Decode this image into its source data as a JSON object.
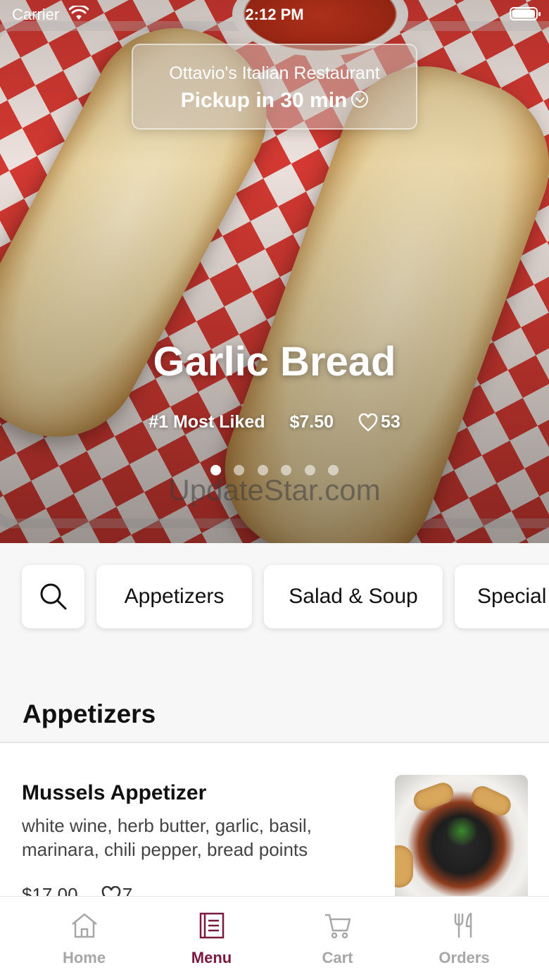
{
  "status_bar": {
    "carrier": "Carrier",
    "time": "2:12 PM"
  },
  "header": {
    "restaurant_name": "Ottavio's Italian Restaurant",
    "pickup_label": "Pickup in 30 min"
  },
  "featured": {
    "title": "Garlic Bread",
    "rank": "#1 Most Liked",
    "price": "$7.50",
    "likes": "53",
    "carousel_pages": 6,
    "carousel_active": 1,
    "watermark": "UpdateStar.com"
  },
  "categories": [
    "Appetizers",
    "Salad & Soup",
    "Special"
  ],
  "section": {
    "title": "Appetizers"
  },
  "items": [
    {
      "name": "Mussels Appetizer",
      "description": "white wine, herb butter, garlic, basil, marinara, chili pepper, bread points",
      "price": "$17.00",
      "likes": "7"
    }
  ],
  "tabs": [
    {
      "label": "Home",
      "icon": "home-icon",
      "active": false
    },
    {
      "label": "Menu",
      "icon": "menu-icon",
      "active": true
    },
    {
      "label": "Cart",
      "icon": "cart-icon",
      "active": false
    },
    {
      "label": "Orders",
      "icon": "fork-knife-icon",
      "active": false
    }
  ],
  "colors": {
    "accent": "#7a1a3c",
    "inactive": "#a7a7a7"
  }
}
